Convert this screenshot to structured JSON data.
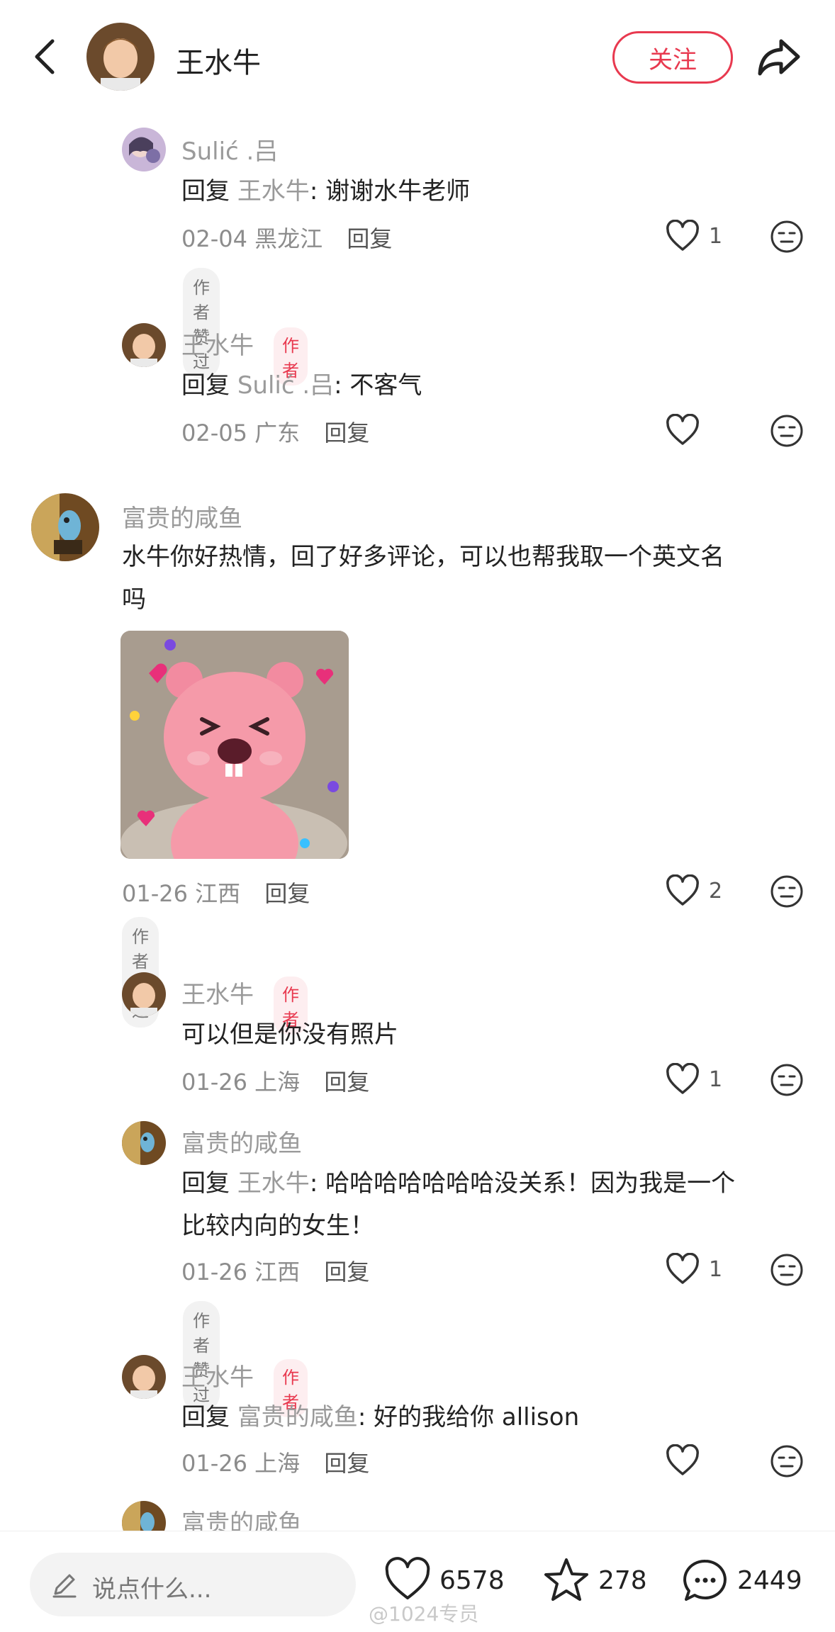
{
  "header": {
    "name": "王水牛",
    "follow_label": "关注"
  },
  "comments": [
    {
      "user": "Sulić .吕",
      "reply_prefix": "回复",
      "reply_to": "王水牛",
      "body": ": 谢谢水牛老师",
      "date": "02-04",
      "location": "黑龙江",
      "reply_label": "回复",
      "likes": "1",
      "liked_badge": "作者赞过"
    },
    {
      "user": "王水牛",
      "tag": "作者",
      "reply_prefix": "回复",
      "reply_to": "Sulić .吕",
      "body": ": 不客气",
      "date": "02-05",
      "location": "广东",
      "reply_label": "回复"
    },
    {
      "user": "富贵的咸鱼",
      "body_line1": "水牛你好热情，回了好多评论，可以也帮我取一个英文名",
      "body_line2": "吗",
      "date": "01-26",
      "location": "江西",
      "reply_label": "回复",
      "likes": "2",
      "liked_badge": "作者赞过"
    },
    {
      "user": "王水牛",
      "tag": "作者",
      "body": "可以但是你没有照片",
      "date": "01-26",
      "location": "上海",
      "reply_label": "回复",
      "likes": "1"
    },
    {
      "user": "富贵的咸鱼",
      "reply_prefix": "回复",
      "reply_to": "王水牛",
      "body_line1": ": 哈哈哈哈哈哈哈没关系！因为我是一个",
      "body_line2": "比较内向的女生！",
      "date": "01-26",
      "location": "江西",
      "reply_label": "回复",
      "likes": "1",
      "liked_badge": "作者赞过"
    },
    {
      "user": "王水牛",
      "tag": "作者",
      "reply_prefix": "回复",
      "reply_to": "富贵的咸鱼",
      "body": ": 好的我给你 allison",
      "date": "01-26",
      "location": "上海",
      "reply_label": "回复"
    },
    {
      "user": "富贵的咸鱼"
    }
  ],
  "bottom": {
    "placeholder": "说点什么...",
    "likes": "6578",
    "stars": "278",
    "comments": "2449"
  },
  "watermark": "@1024专员",
  "icons": [
    "back-arrow-icon",
    "share-icon",
    "heart-icon",
    "neutral-face-icon",
    "pencil-icon",
    "star-icon",
    "speech-bubble-icon"
  ]
}
